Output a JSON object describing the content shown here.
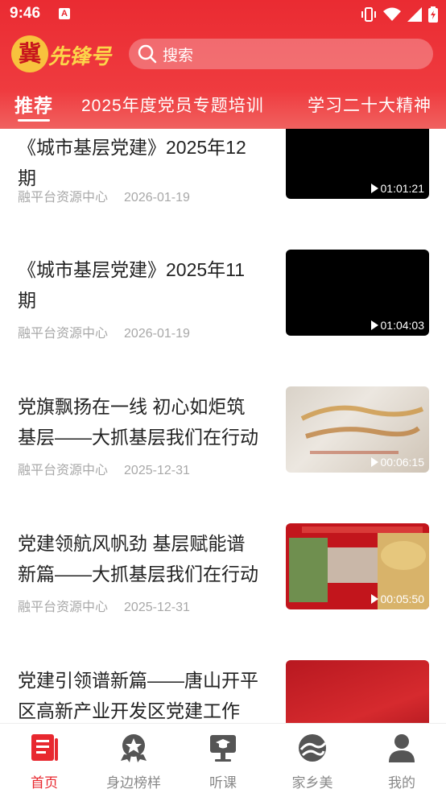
{
  "status_bar": {
    "time": "9:46",
    "notification_badge": "A"
  },
  "header": {
    "logo_char": "冀",
    "logo_text": "先锋号",
    "search_placeholder": "搜索"
  },
  "tabs": [
    {
      "label": "推荐",
      "active": true
    },
    {
      "label": "2025年度党员专题培训",
      "active": false
    },
    {
      "label": "学习二十大精神",
      "active": false
    }
  ],
  "items": [
    {
      "title": "《城市基层党建》2025年12期",
      "source": "融平台资源中心",
      "date": "2026-01-19",
      "duration": "01:01:21",
      "thumb": "black"
    },
    {
      "title": "《城市基层党建》2025年11期",
      "source": "融平台资源中心",
      "date": "2026-01-19",
      "duration": "01:04:03",
      "thumb": "black"
    },
    {
      "title": "党旗飘扬在一线 初心如炬筑基层——大抓基层我们在行动",
      "source": "融平台资源中心",
      "date": "2025-12-31",
      "duration": "00:06:15",
      "thumb": "gold"
    },
    {
      "title": "党建领航风帆劲 基层赋能谱新篇——大抓基层我们在行动",
      "source": "融平台资源中心",
      "date": "2025-12-31",
      "duration": "00:05:50",
      "thumb": "red-collage"
    },
    {
      "title": "党建引领谱新篇——唐山开平区高新产业开发区党建工作",
      "source": "",
      "date": "",
      "duration": "",
      "thumb": "red"
    }
  ],
  "bottom_nav": [
    {
      "label": "首页",
      "icon": "home-doc-icon",
      "active": true
    },
    {
      "label": "身边榜样",
      "icon": "star-badge-icon",
      "active": false
    },
    {
      "label": "听课",
      "icon": "podium-icon",
      "active": false
    },
    {
      "label": "家乡美",
      "icon": "landscape-icon",
      "active": false
    },
    {
      "label": "我的",
      "icon": "user-icon",
      "active": false
    }
  ],
  "colors": {
    "brand_red": "#e8282f",
    "logo_gold": "#f8c23d"
  }
}
